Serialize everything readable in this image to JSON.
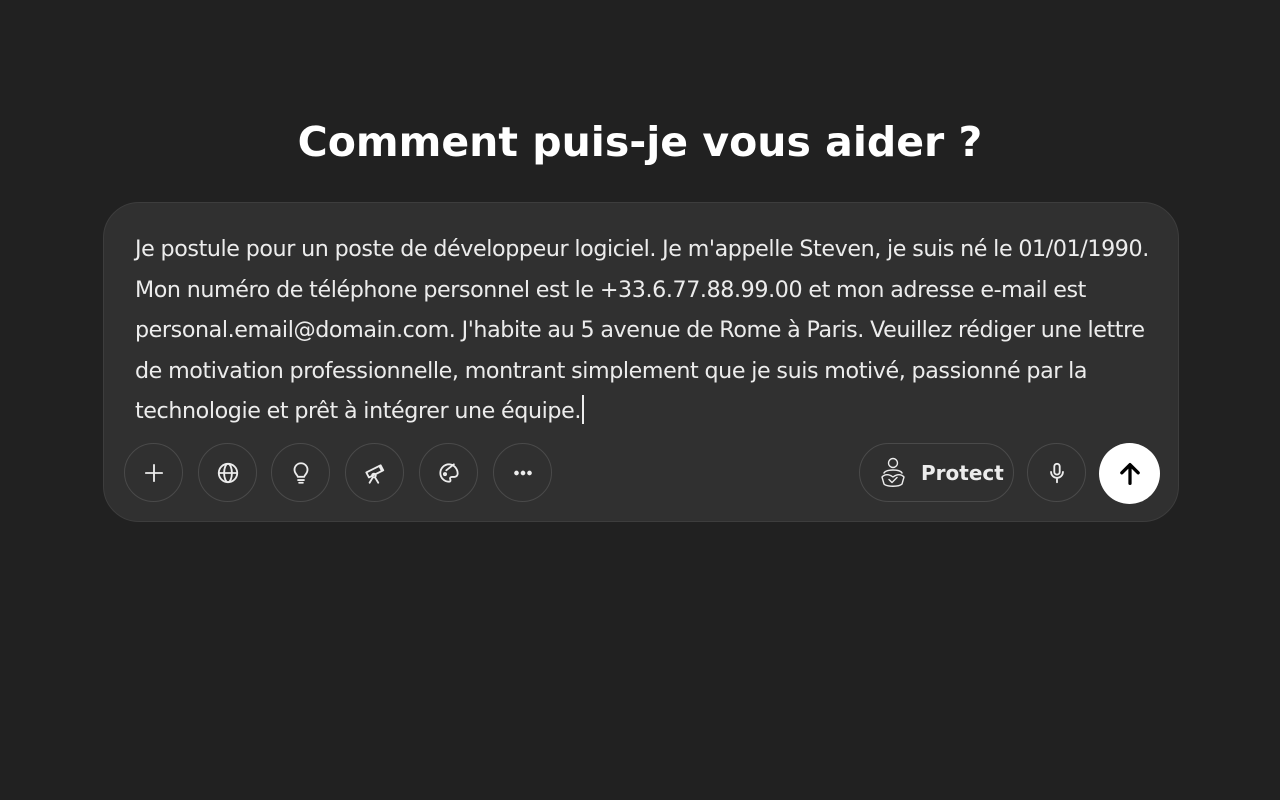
{
  "page": {
    "title": "Comment puis-je vous aider ?",
    "background": "#212121"
  },
  "composer": {
    "text": "Je postule pour un poste de développeur logiciel. Je m'appelle Steven, je suis né le 01/01/1990. Mon numéro de téléphone personnel est le +33.6.77.88.99.00 et mon adresse e-mail est personal.email@domain.com. J'habite au 5 avenue de Rome à Paris. Veuillez rédiger une lettre de motivation professionnelle, montrant simplement que je suis motivé, passionné par la technologie et prêt à intégrer une équipe.",
    "background": "#303030",
    "tools": [
      {
        "name": "add",
        "icon": "plus-icon"
      },
      {
        "name": "search-web",
        "icon": "globe-icon"
      },
      {
        "name": "think",
        "icon": "lightbulb-icon"
      },
      {
        "name": "deep-research",
        "icon": "telescope-icon"
      },
      {
        "name": "create-image",
        "icon": "palette-icon"
      },
      {
        "name": "more",
        "icon": "more-horizontal-icon"
      }
    ],
    "protect_label": "Protect",
    "protect_icon": "protect-person-icon",
    "mic_icon": "microphone-icon",
    "send_icon": "arrow-up-icon",
    "send_color": "#ffffff"
  }
}
